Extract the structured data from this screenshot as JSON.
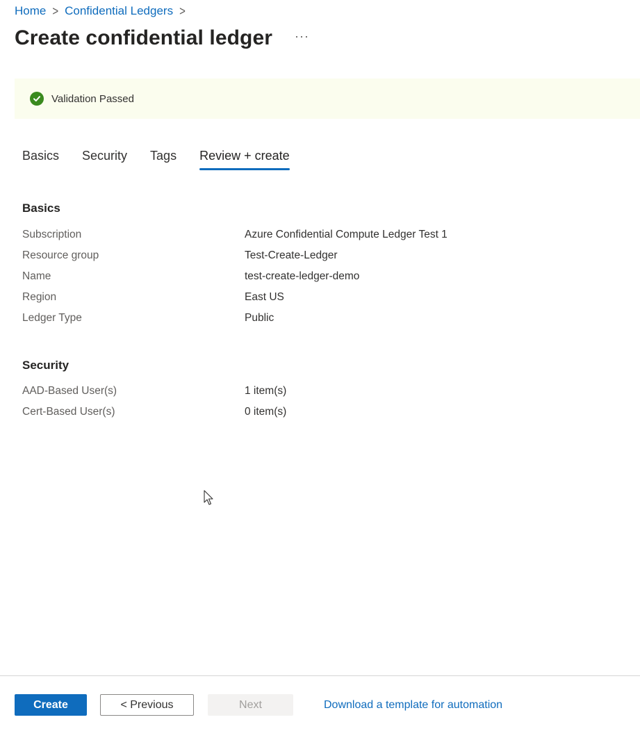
{
  "breadcrumb": {
    "home": "Home",
    "parent": "Confidential Ledgers"
  },
  "header": {
    "title": "Create confidential ledger",
    "more_label": "···"
  },
  "validation": {
    "message": "Validation Passed",
    "status_color": "#3a8a1e"
  },
  "tabs": [
    {
      "label": "Basics",
      "active": false
    },
    {
      "label": "Security",
      "active": false
    },
    {
      "label": "Tags",
      "active": false
    },
    {
      "label": "Review + create",
      "active": true
    }
  ],
  "basics": {
    "heading": "Basics",
    "rows": [
      {
        "label": "Subscription",
        "value": "Azure Confidential Compute Ledger Test 1"
      },
      {
        "label": "Resource group",
        "value": "Test-Create-Ledger"
      },
      {
        "label": "Name",
        "value": "test-create-ledger-demo"
      },
      {
        "label": "Region",
        "value": "East US"
      },
      {
        "label": "Ledger Type",
        "value": "Public"
      }
    ]
  },
  "security": {
    "heading": "Security",
    "rows": [
      {
        "label": "AAD-Based User(s)",
        "value": "1 item(s)"
      },
      {
        "label": "Cert-Based User(s)",
        "value": "0 item(s)"
      }
    ]
  },
  "footer": {
    "create_label": "Create",
    "previous_label": "< Previous",
    "next_label": "Next",
    "download_link": "Download a template for automation"
  },
  "colors": {
    "accent": "#0f6cbd",
    "banner_bg": "#fbfdee"
  },
  "icons": {
    "validation": "check-circle-icon",
    "breadcrumb_separator": "chevron-right-icon",
    "cursor": "mouse-pointer-icon"
  }
}
